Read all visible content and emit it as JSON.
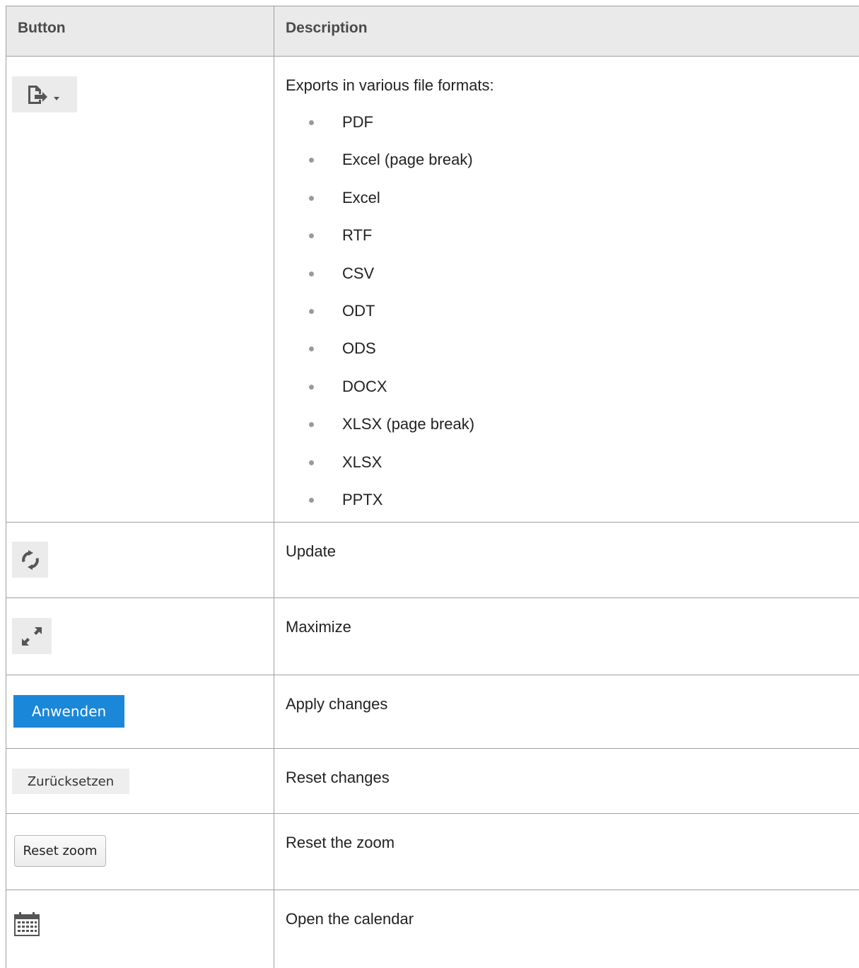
{
  "table": {
    "headers": {
      "button": "Button",
      "description": "Description"
    },
    "rows": [
      {
        "icon": "export-icon",
        "description": "Exports in various file formats:",
        "formats": [
          "PDF",
          "Excel (page break)",
          "Excel",
          "RTF",
          "CSV",
          "ODT",
          "ODS",
          "DOCX",
          "XLSX (page break)",
          "XLSX",
          "PPTX"
        ]
      },
      {
        "icon": "refresh-icon",
        "description": "Update"
      },
      {
        "icon": "maximize-icon",
        "description": "Maximize"
      },
      {
        "button_label": "Anwenden",
        "description": "Apply changes"
      },
      {
        "button_label": "Zurücksetzen",
        "description": "Reset changes"
      },
      {
        "button_label": "Reset zoom",
        "description": "Reset the zoom"
      },
      {
        "icon": "calendar-icon",
        "description": "Open the calendar"
      }
    ]
  },
  "colors": {
    "apply_button": "#1b87d8",
    "header_background": "#eaeaea",
    "border": "#a0a0a0"
  }
}
